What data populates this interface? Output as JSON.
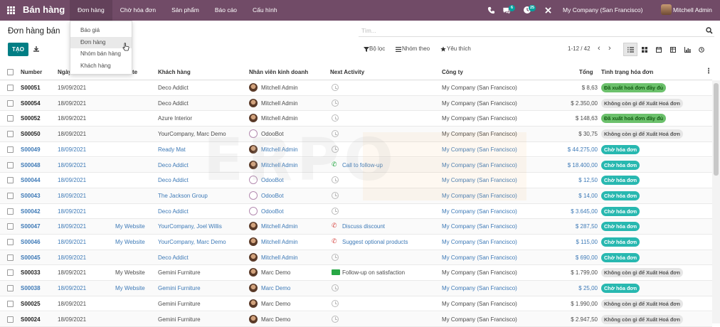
{
  "app": {
    "name": "Bán hàng"
  },
  "menu": [
    "Đơn hàng",
    "Chờ hóa đơn",
    "Sản phẩm",
    "Báo cáo",
    "Cấu hình"
  ],
  "systray": {
    "chat_count": "6",
    "activity_count": "25",
    "company": "My Company (San Francisco)",
    "user": "Mitchell Admin"
  },
  "dropdown": [
    "Báo giá",
    "Đơn hàng",
    "Nhóm bán hàng",
    "Khách hàng"
  ],
  "page": {
    "title": "Đơn hàng bán",
    "search_placeholder": "Tìm...",
    "create": "TẠO"
  },
  "filters": {
    "filter": "Bộ lọc",
    "group": "Nhóm theo",
    "favorite": "Yêu thích"
  },
  "pager": "1-12 / 42",
  "columns": {
    "number": "Number",
    "date": "Ngày",
    "website": "te",
    "customer": "Khách hàng",
    "salesperson": "Nhân viên kinh doanh",
    "activity": "Next Activity",
    "company": "Công ty",
    "total": "Tổng",
    "invoice_status": "Tình trạng hóa đơn"
  },
  "rows": [
    {
      "number": "S00051",
      "date": "19/09/2021",
      "website": "",
      "customer": "Deco Addict",
      "salesperson": "Mitchell Admin",
      "bot": false,
      "activity_type": "clock",
      "activity": "",
      "company": "My Company (San Francisco)",
      "total": "$ 8,63",
      "status": "Đã xuất hoá đơn đầy đủ",
      "status_kind": "done",
      "highlight": false
    },
    {
      "number": "S00054",
      "date": "18/09/2021",
      "website": "",
      "customer": "Deco Addict",
      "salesperson": "Mitchell Admin",
      "bot": false,
      "activity_type": "clock",
      "activity": "",
      "company": "My Company (San Francisco)",
      "total": "$ 2.350,00",
      "status": "Không còn gì để Xuất Hoá đơn",
      "status_kind": "none",
      "highlight": false
    },
    {
      "number": "S00052",
      "date": "18/09/2021",
      "website": "",
      "customer": "Azure Interior",
      "salesperson": "Mitchell Admin",
      "bot": false,
      "activity_type": "clock",
      "activity": "",
      "company": "My Company (San Francisco)",
      "total": "$ 148,63",
      "status": "Đã xuất hoá đơn đầy đủ",
      "status_kind": "done",
      "highlight": false
    },
    {
      "number": "S00050",
      "date": "18/09/2021",
      "website": "",
      "customer": "YourCompany, Marc Demo",
      "salesperson": "OdooBot",
      "bot": true,
      "activity_type": "clock",
      "activity": "",
      "company": "My Company (San Francisco)",
      "total": "$ 30,75",
      "status": "Không còn gì để Xuất Hoá đơn",
      "status_kind": "none",
      "highlight": false
    },
    {
      "number": "S00049",
      "date": "18/09/2021",
      "website": "",
      "customer": "Ready Mat",
      "salesperson": "Mitchell Admin",
      "bot": false,
      "activity_type": "clock",
      "activity": "",
      "company": "My Company (San Francisco)",
      "total": "$ 44.275,00",
      "status": "Chờ hóa đơn",
      "status_kind": "wait",
      "highlight": true
    },
    {
      "number": "S00048",
      "date": "18/09/2021",
      "website": "",
      "customer": "Deco Addict",
      "salesperson": "Mitchell Admin",
      "bot": false,
      "activity_type": "phone-green",
      "activity": "Call to follow-up",
      "company": "My Company (San Francisco)",
      "total": "$ 18.400,00",
      "status": "Chờ hóa đơn",
      "status_kind": "wait",
      "highlight": true
    },
    {
      "number": "S00044",
      "date": "18/09/2021",
      "website": "",
      "customer": "Deco Addict",
      "salesperson": "OdooBot",
      "bot": true,
      "activity_type": "clock",
      "activity": "",
      "company": "My Company (San Francisco)",
      "total": "$ 12,50",
      "status": "Chờ hóa đơn",
      "status_kind": "wait",
      "highlight": true
    },
    {
      "number": "S00043",
      "date": "18/09/2021",
      "website": "",
      "customer": "The Jackson Group",
      "salesperson": "OdooBot",
      "bot": true,
      "activity_type": "clock",
      "activity": "",
      "company": "My Company (San Francisco)",
      "total": "$ 14,00",
      "status": "Chờ hóa đơn",
      "status_kind": "wait",
      "highlight": true
    },
    {
      "number": "S00042",
      "date": "18/09/2021",
      "website": "",
      "customer": "Deco Addict",
      "salesperson": "OdooBot",
      "bot": true,
      "activity_type": "clock",
      "activity": "",
      "company": "My Company (San Francisco)",
      "total": "$ 3.645,00",
      "status": "Chờ hóa đơn",
      "status_kind": "wait",
      "highlight": true
    },
    {
      "number": "S00047",
      "date": "18/09/2021",
      "website": "My Website",
      "customer": "YourCompany, Joel Willis",
      "salesperson": "Mitchell Admin",
      "bot": false,
      "activity_type": "phone-red",
      "activity": "Discuss discount",
      "company": "My Company (San Francisco)",
      "total": "$ 287,50",
      "status": "Chờ hóa đơn",
      "status_kind": "wait",
      "highlight": true
    },
    {
      "number": "S00046",
      "date": "18/09/2021",
      "website": "My Website",
      "customer": "YourCompany, Marc Demo",
      "salesperson": "Mitchell Admin",
      "bot": false,
      "activity_type": "phone-red",
      "activity": "Suggest optional products",
      "company": "My Company (San Francisco)",
      "total": "$ 115,00",
      "status": "Chờ hóa đơn",
      "status_kind": "wait",
      "highlight": true
    },
    {
      "number": "S00045",
      "date": "18/09/2021",
      "website": "",
      "customer": "Deco Addict",
      "salesperson": "Mitchell Admin",
      "bot": false,
      "activity_type": "clock",
      "activity": "",
      "company": "My Company (San Francisco)",
      "total": "$ 690,00",
      "status": "Chờ hóa đơn",
      "status_kind": "wait",
      "highlight": true
    },
    {
      "number": "S00033",
      "date": "18/09/2021",
      "website": "My Website",
      "customer": "Gemini Furniture",
      "salesperson": "Marc Demo",
      "bot": false,
      "activity_type": "money",
      "activity": "Follow-up on satisfaction",
      "company": "My Company (San Francisco)",
      "total": "$ 1.799,00",
      "status": "Không còn gì để Xuất Hoá đơn",
      "status_kind": "none",
      "highlight": false
    },
    {
      "number": "S00038",
      "date": "18/09/2021",
      "website": "My Website",
      "customer": "Gemini Furniture",
      "salesperson": "Marc Demo",
      "bot": false,
      "activity_type": "clock",
      "activity": "",
      "company": "My Company (San Francisco)",
      "total": "$ 25,00",
      "status": "Chờ hóa đơn",
      "status_kind": "wait",
      "highlight": true
    },
    {
      "number": "S00025",
      "date": "18/09/2021",
      "website": "",
      "customer": "Gemini Furniture",
      "salesperson": "Marc Demo",
      "bot": false,
      "activity_type": "clock",
      "activity": "",
      "company": "My Company (San Francisco)",
      "total": "$ 1.990,00",
      "status": "Không còn gì để Xuất Hoá đơn",
      "status_kind": "none",
      "highlight": false
    },
    {
      "number": "S00024",
      "date": "18/09/2021",
      "website": "",
      "customer": "Gemini Furniture",
      "salesperson": "Marc Demo",
      "bot": false,
      "activity_type": "clock",
      "activity": "",
      "company": "My Company (San Francisco)",
      "total": "$ 2.947,50",
      "status": "Không còn gì để Xuất Hoá đơn",
      "status_kind": "none",
      "highlight": false
    }
  ],
  "watermark": "ERPO"
}
